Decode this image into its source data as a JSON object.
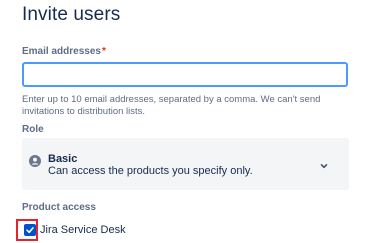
{
  "page": {
    "title": "Invite users"
  },
  "email": {
    "label": "Email addresses",
    "required_marker": "*",
    "value": "",
    "placeholder": "",
    "helper": "Enter up to 10 email addresses, separated by a comma. We can't send invitations to distribution lists."
  },
  "role": {
    "label": "Role",
    "selected_name": "Basic",
    "selected_description": "Can access the products you specify only.",
    "icon": "person-icon"
  },
  "products": {
    "label": "Product access",
    "items": [
      {
        "label": "Jira Service Desk",
        "checked": true
      }
    ]
  },
  "colors": {
    "accent": "#0052cc",
    "focus_border": "#4c9aff",
    "required": "#de350b",
    "highlight": "#e5222d"
  }
}
